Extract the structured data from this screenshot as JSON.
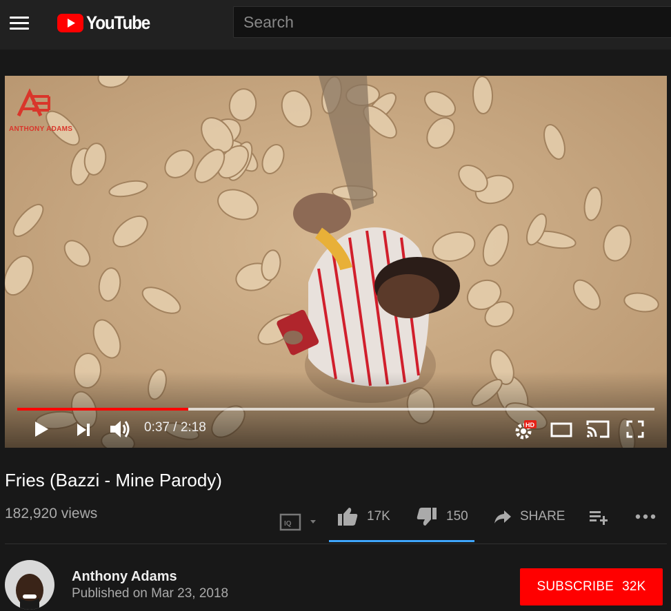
{
  "header": {
    "logo_text": "YouTube",
    "search_placeholder": "Search"
  },
  "player": {
    "watermark_text": "ANTHONY ADAMS",
    "current_time": "0:37",
    "duration": "2:18",
    "time_display": "0:37 / 2:18",
    "progress_fraction": 0.268,
    "buffered_fraction": 1.0,
    "quality_badge": "HD"
  },
  "video": {
    "title": "Fries (Bazzi - Mine Parody)",
    "views": "182,920 views"
  },
  "actions": {
    "likes": "17K",
    "dislikes": "150",
    "share_label": "SHARE",
    "like_ratio": 0.99
  },
  "channel": {
    "name": "Anthony Adams",
    "published": "Published on Mar 23, 2018",
    "subscribe_label": "SUBSCRIBE",
    "subscriber_count": "32K"
  },
  "colors": {
    "accent": "#ff0000",
    "like_bar": "#3ea6ff",
    "background": "#181818",
    "masthead": "#212121"
  },
  "icons": [
    "menu-icon",
    "youtube-logo-icon",
    "play-icon",
    "next-icon",
    "volume-icon",
    "settings-icon",
    "theater-icon",
    "cast-icon",
    "fullscreen-icon",
    "save-to-playlist-icon",
    "like-icon",
    "dislike-icon",
    "share-icon",
    "add-to-playlist-icon",
    "more-icon"
  ]
}
